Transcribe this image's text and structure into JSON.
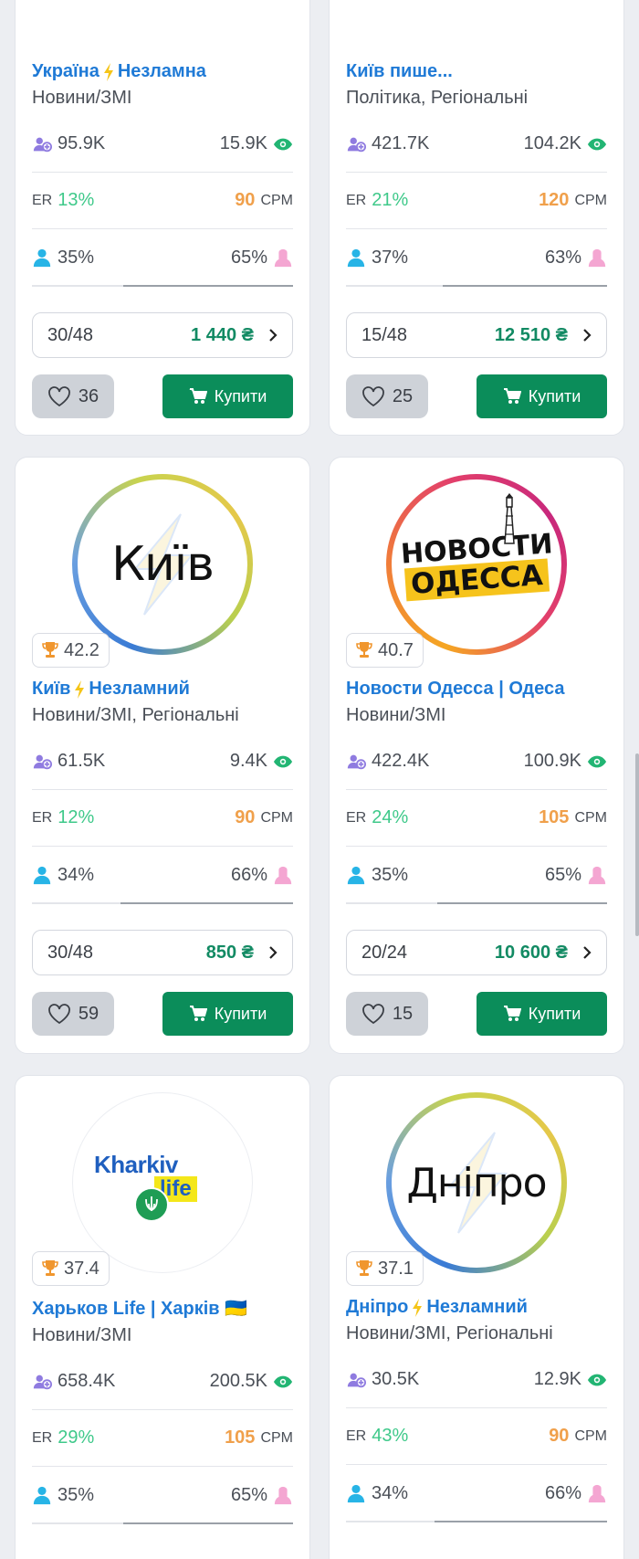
{
  "labels": {
    "er": "ER",
    "cpm": "CPM",
    "buy": "Купити"
  },
  "colors": {
    "title": "#1f7ad6",
    "er": "#3fc98a",
    "cpm": "#f0a04b",
    "price": "#128a63",
    "buy_button": "#0b8d5a",
    "like_button": "#ced2d8"
  },
  "icons": [
    "subscribers-icon",
    "eye-icon",
    "male-icon",
    "female-icon",
    "trophy-icon",
    "heart-icon",
    "cart-icon",
    "chevron-right-icon",
    "bolt-icon"
  ],
  "cards": [
    {
      "title_part1": "Україна",
      "title_part2": "Незламна",
      "title_bolt": true,
      "category": "Новини/ЗМІ",
      "subscribers": "95.9K",
      "views": "15.9K",
      "er": "13%",
      "cpm": "90",
      "male": "35%",
      "female": "65%",
      "male_share": 0.35,
      "slots": "30/48",
      "price": "1 440 ₴",
      "likes": "36"
    },
    {
      "title_part1": "Київ пише...",
      "title_part2": "",
      "title_bolt": false,
      "category": "Політика, Регіональні",
      "subscribers": "421.7K",
      "views": "104.2K",
      "er": "21%",
      "cpm": "120",
      "male": "37%",
      "female": "63%",
      "male_share": 0.37,
      "slots": "15/48",
      "price": "12 510 ₴",
      "likes": "25"
    },
    {
      "avatar_text": "Київ",
      "rating": "42.2",
      "title_part1": "Київ",
      "title_part2": "Незламний",
      "title_bolt": true,
      "category": "Новини/ЗМІ, Регіональні",
      "subscribers": "61.5K",
      "views": "9.4K",
      "er": "12%",
      "cpm": "90",
      "male": "34%",
      "female": "66%",
      "male_share": 0.34,
      "slots": "30/48",
      "price": "850 ₴",
      "likes": "59"
    },
    {
      "avatar_line1": "НОВОСТИ",
      "avatar_line2": "ОДЕССА",
      "rating": "40.7",
      "title_part1": "Новости Одесса | Одеса",
      "title_part2": "",
      "title_bolt": false,
      "category": "Новини/ЗМІ",
      "subscribers": "422.4K",
      "views": "100.9K",
      "er": "24%",
      "cpm": "105",
      "male": "35%",
      "female": "65%",
      "male_share": 0.35,
      "slots": "20/24",
      "price": "10 600 ₴",
      "likes": "15"
    },
    {
      "avatar_line1": "Kharkiv",
      "avatar_line2": "life",
      "rating": "37.4",
      "title_part1": "Харьков Life | Харків 🇺🇦",
      "title_part2": "",
      "title_bolt": false,
      "category": "Новини/ЗМІ",
      "subscribers": "658.4K",
      "views": "200.5K",
      "er": "29%",
      "cpm": "105",
      "male": "35%",
      "female": "65%",
      "male_share": 0.35
    },
    {
      "avatar_text": "Дніпро",
      "rating": "37.1",
      "title_part1": "Дніпро",
      "title_part2": "Незламний",
      "title_bolt": true,
      "category": "Новини/ЗМІ, Регіональні",
      "subscribers": "30.5K",
      "views": "12.9K",
      "er": "43%",
      "cpm": "90",
      "male": "34%",
      "female": "66%",
      "male_share": 0.34
    }
  ]
}
